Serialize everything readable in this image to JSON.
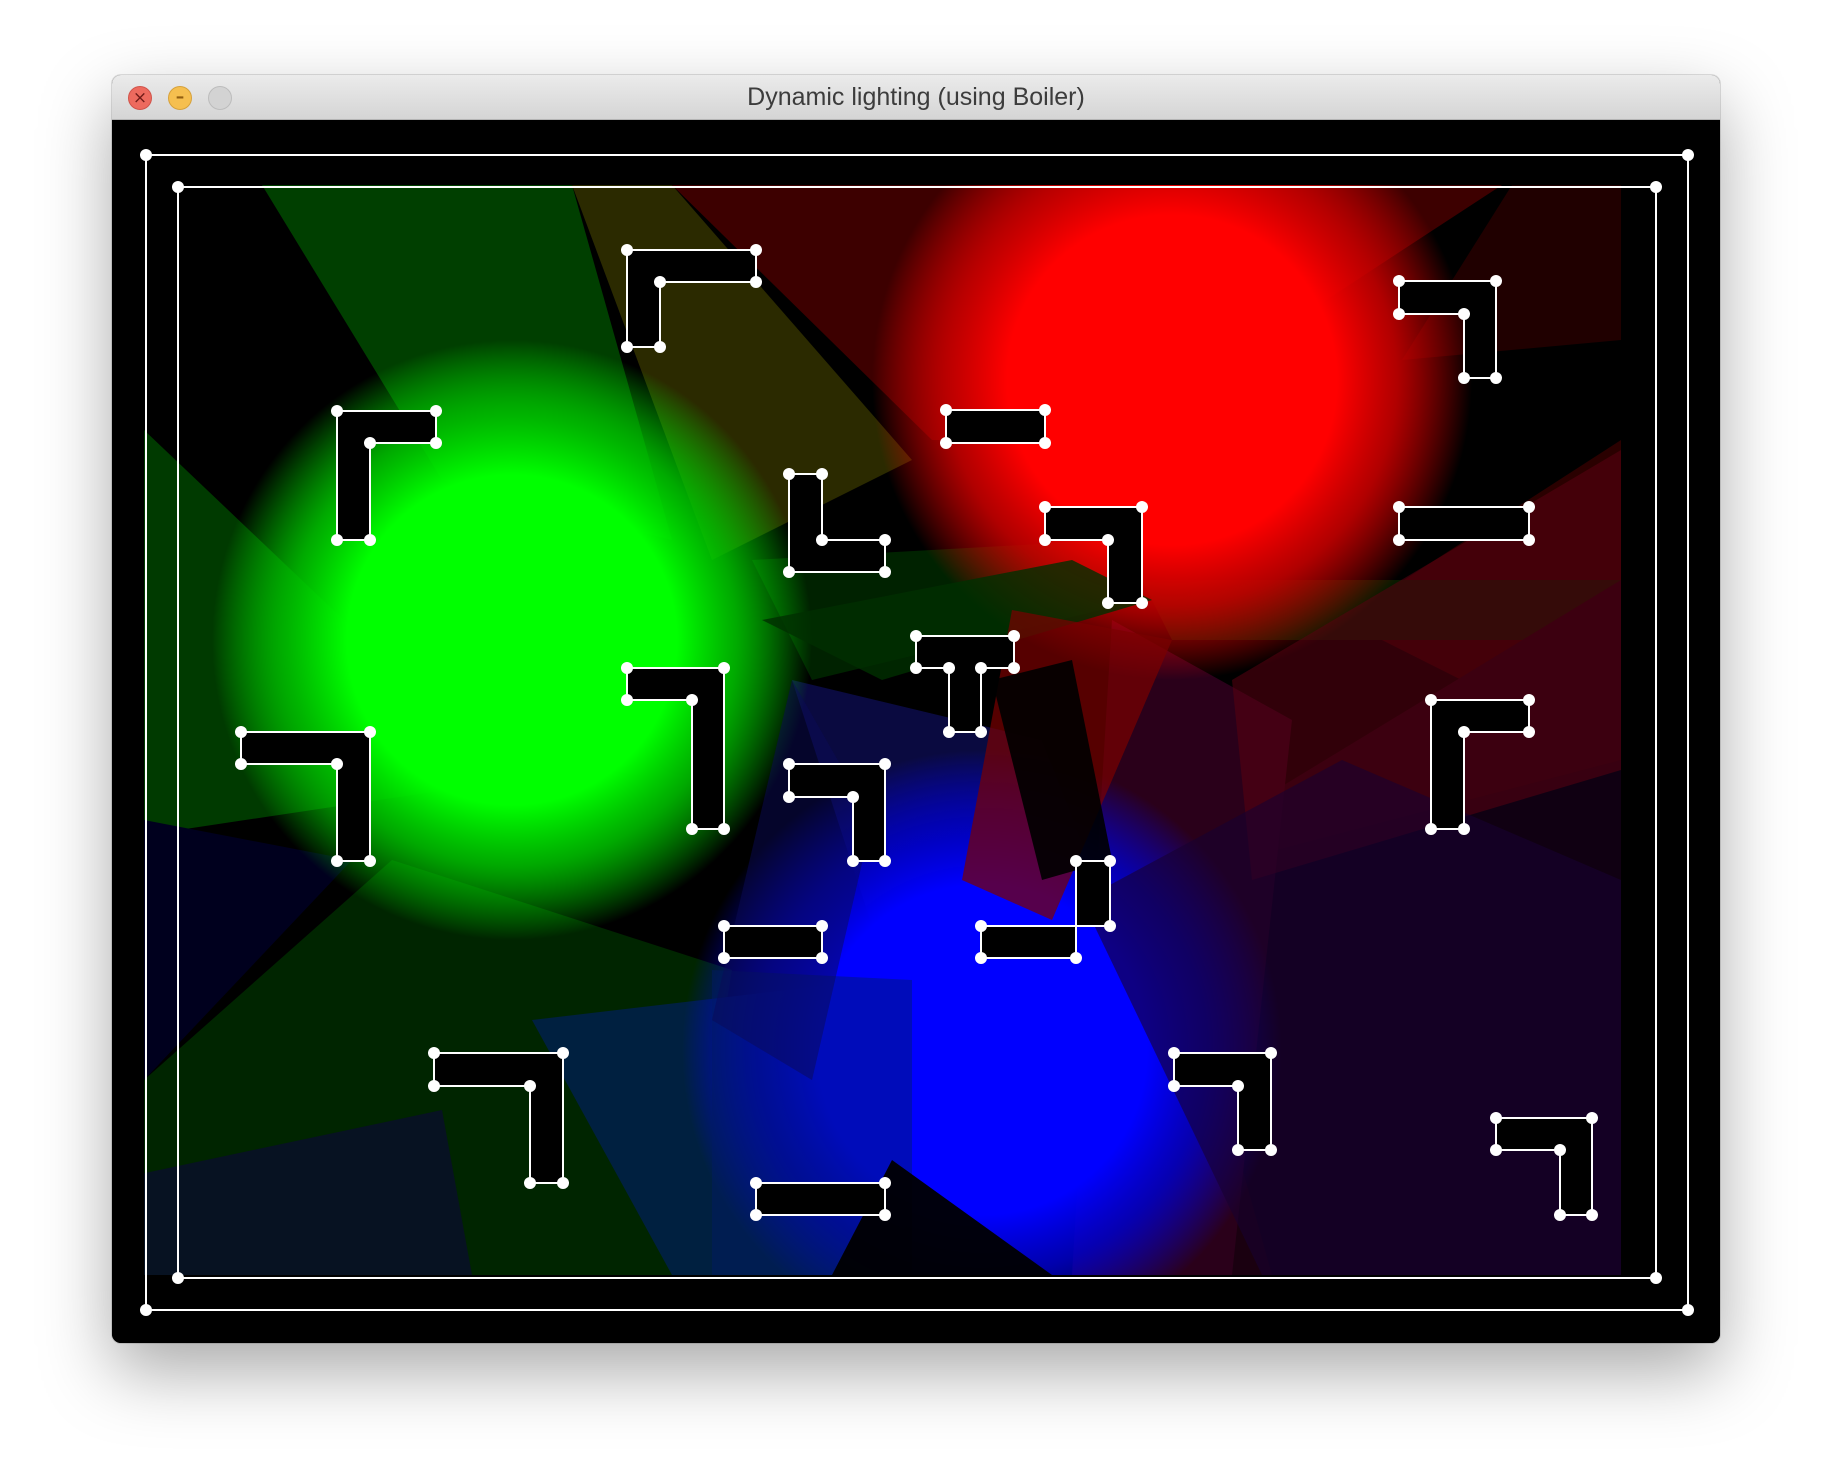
{
  "window": {
    "title": "Dynamic lighting (using Boiler)",
    "buttons": [
      "close",
      "minimize",
      "zoom"
    ]
  },
  "scene": {
    "background": "#000000",
    "edge_color": "#ffffff",
    "vertex_color": "#ffffff",
    "lights": [
      {
        "name": "green-light",
        "color": "#00ff00"
      },
      {
        "name": "red-light",
        "color": "#ff0000"
      },
      {
        "name": "blue-light",
        "color": "#0000ff"
      }
    ],
    "icons": {
      "close": "close-icon",
      "minimize": "minimize-icon",
      "zoom": "zoom-icon"
    }
  }
}
